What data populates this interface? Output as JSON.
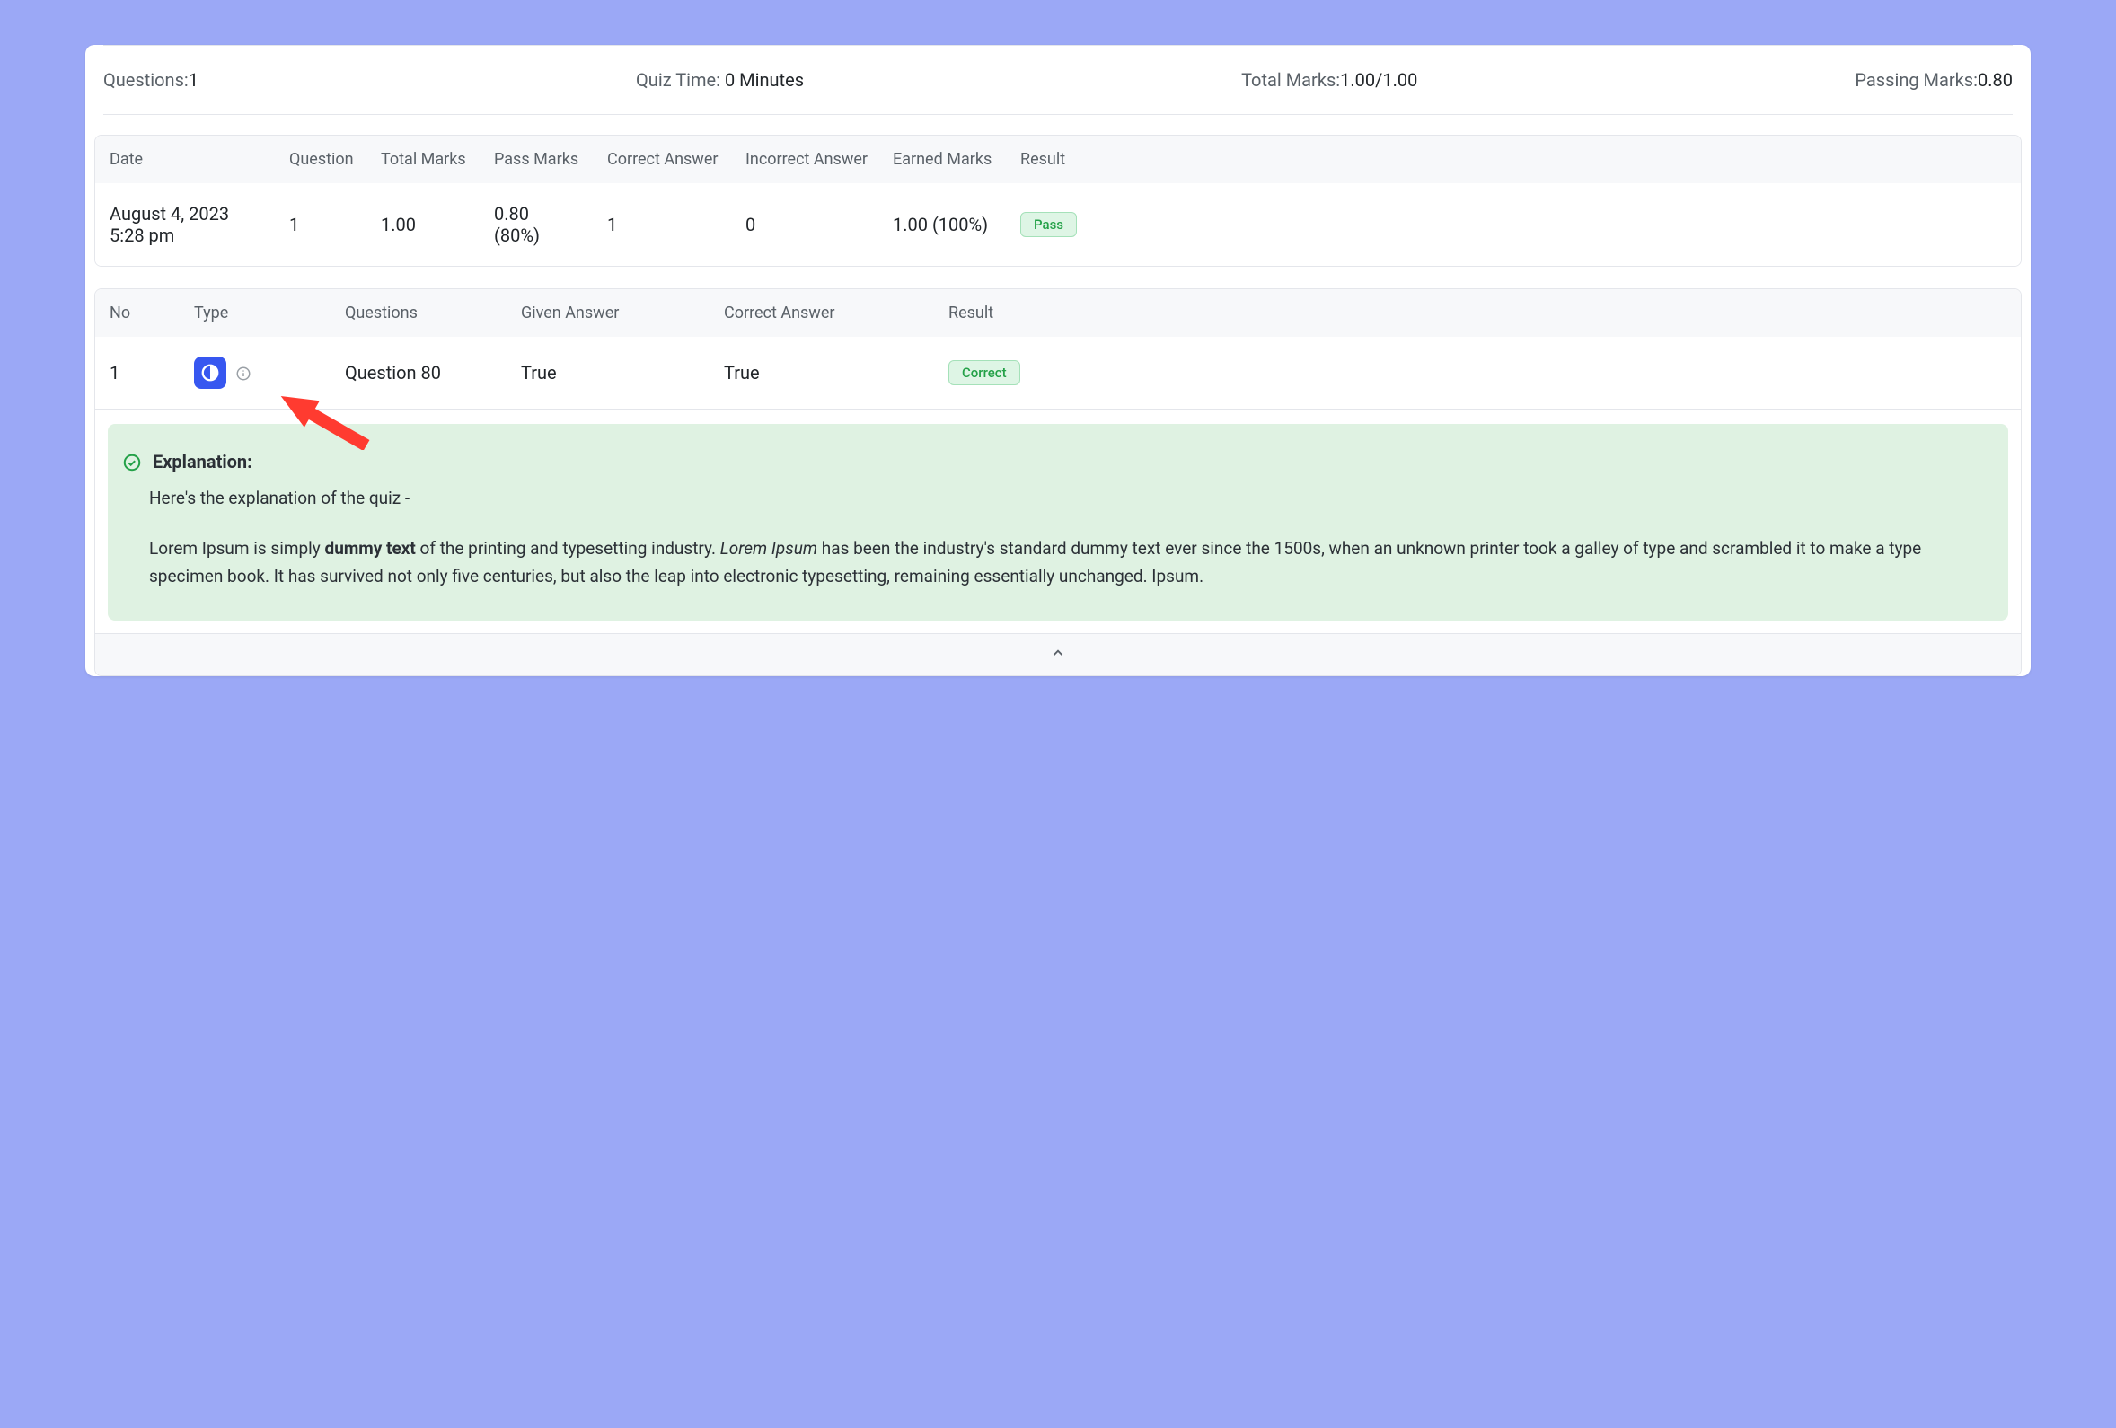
{
  "summary": {
    "questions_label": "Questions:",
    "questions_value": "1",
    "quiz_time_label": "Quiz Time:",
    "quiz_time_value": "0 Minutes",
    "total_marks_label": "Total Marks:",
    "total_marks_value": "1.00/1.00",
    "passing_marks_label": "Passing Marks:",
    "passing_marks_value": "0.80"
  },
  "attempts": {
    "headers": {
      "date": "Date",
      "question": "Question",
      "total_marks": "Total Marks",
      "pass_marks": "Pass Marks",
      "correct": "Correct Answer",
      "incorrect": "Incorrect Answer",
      "earned": "Earned Marks",
      "result": "Result"
    },
    "row": {
      "date_line1": "August 4, 2023",
      "date_line2": "5:28 pm",
      "question": "1",
      "total_marks": "1.00",
      "pass_marks_line1": "0.80",
      "pass_marks_line2": "(80%)",
      "correct": "1",
      "incorrect": "0",
      "earned": "1.00 (100%)",
      "result": "Pass"
    }
  },
  "details": {
    "headers": {
      "no": "No",
      "type": "Type",
      "questions": "Questions",
      "given": "Given Answer",
      "correct": "Correct Answer",
      "result": "Result"
    },
    "row": {
      "no": "1",
      "type_icon": "contrast-icon",
      "question": "Question 80",
      "given": "True",
      "correct": "True",
      "result": "Correct"
    }
  },
  "explanation": {
    "title": "Explanation:",
    "intro": "Here's the explanation of the quiz -",
    "body_p1_a": "Lorem Ipsum is simply ",
    "body_p1_bold": "dummy text",
    "body_p1_b": " of the printing and typesetting industry. ",
    "body_p1_italic": "Lorem Ipsum",
    "body_p1_c": " has been the industry's standard dummy text ever since the 1500s, when an unknown printer took a galley of type and scrambled it to make a type specimen book. It has survived not only five centuries, but also the leap into electronic typesetting, remaining essentially unchanged. Ipsum."
  },
  "annotation": {
    "arrow_color": "#ff3b30"
  }
}
